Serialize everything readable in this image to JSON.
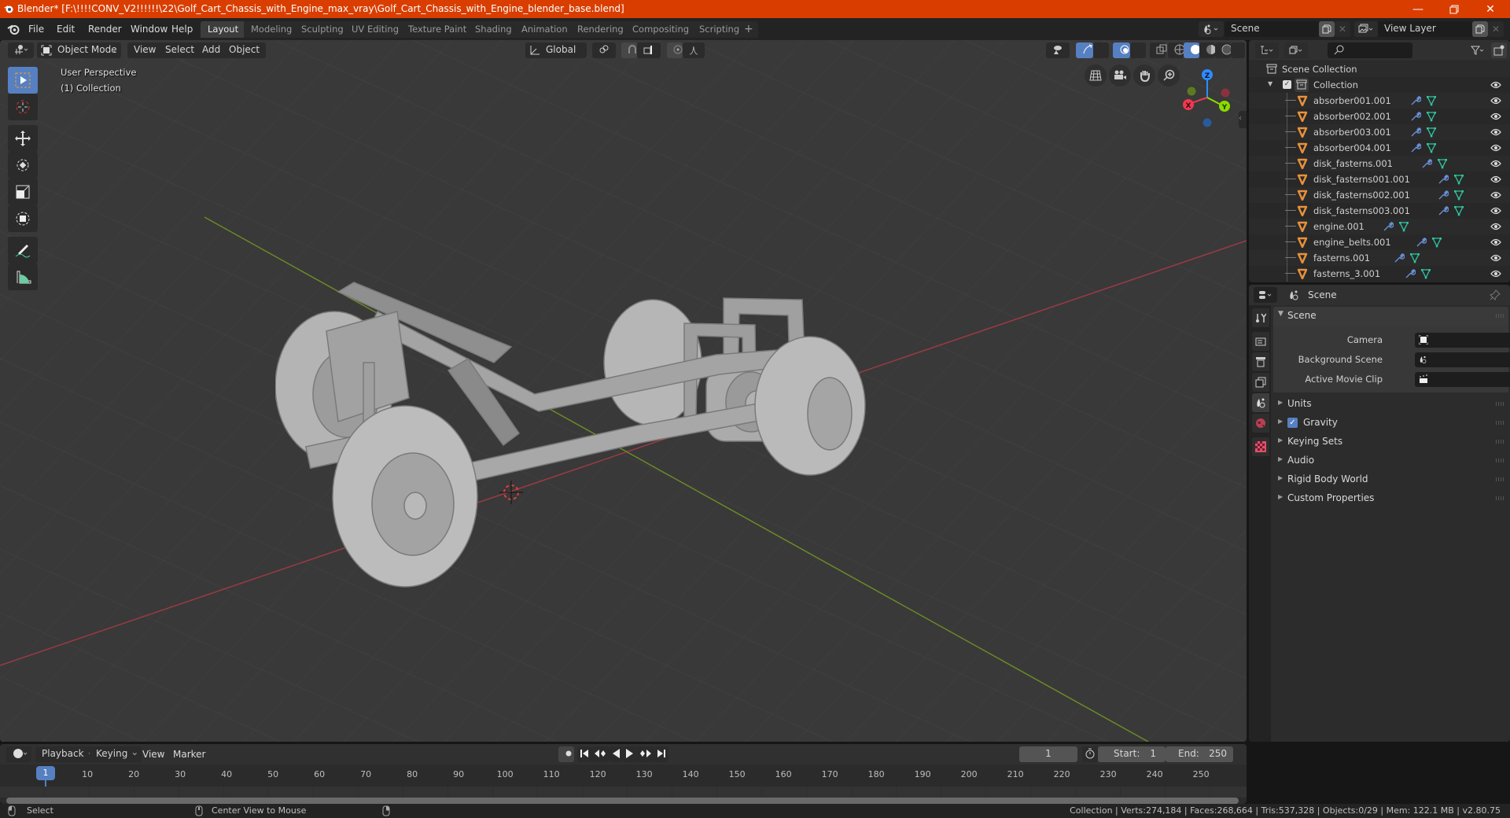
{
  "window": {
    "title": "Blender* [F:\\!!!!CONV_V2!!!!!!\\22\\Golf_Cart_Chassis_with_Engine_max_vray\\Golf_Cart_Chassis_with_Engine_blender_base.blend]",
    "minimize_icon": "minimize-icon",
    "maximize_icon": "restore-icon",
    "close_icon": "close-icon"
  },
  "menubar": {
    "items": [
      "File",
      "Edit",
      "Render",
      "Window",
      "Help"
    ],
    "workspaces": [
      "Layout",
      "Modeling",
      "Sculpting",
      "UV Editing",
      "Texture Paint",
      "Shading",
      "Animation",
      "Rendering",
      "Compositing",
      "Scripting"
    ],
    "active_workspace": "Layout",
    "add_workspace": "+",
    "scene": "Scene",
    "view_layer": "View Layer"
  },
  "viewport": {
    "mode": "Object Mode",
    "menus": [
      "View",
      "Select",
      "Add",
      "Object"
    ],
    "orientation": "Global",
    "overlay_title": "User Perspective",
    "overlay_collection": "(1) Collection",
    "tools": [
      "select-box",
      "cursor",
      "move",
      "rotate",
      "scale",
      "transform",
      "annotate",
      "measure"
    ],
    "gizmo": {
      "x": "X",
      "y": "Y",
      "z": "Z",
      "x_color": "#f0384f",
      "y_color": "#8bdc00",
      "z_color": "#2e8cff"
    }
  },
  "outliner": {
    "root": "Scene Collection",
    "collection": "Collection",
    "items": [
      "absorber001.001",
      "absorber002.001",
      "absorber003.001",
      "absorber004.001",
      "disk_fasterns.001",
      "disk_fasterns001.001",
      "disk_fasterns002.001",
      "disk_fasterns003.001",
      "engine.001",
      "engine_belts.001",
      "fasterns.001",
      "fasterns_3.001"
    ]
  },
  "properties": {
    "context": "Scene",
    "panel_title": "Scene",
    "fields": [
      {
        "label": "Camera",
        "value": ""
      },
      {
        "label": "Background Scene",
        "value": ""
      },
      {
        "label": "Active Movie Clip",
        "value": ""
      }
    ],
    "subpanels": [
      "Units",
      "Gravity",
      "Keying Sets",
      "Audio",
      "Rigid Body World",
      "Custom Properties"
    ],
    "gravity_checked": true
  },
  "timeline": {
    "menus": [
      "Playback",
      "Keying",
      "View",
      "Marker"
    ],
    "current_frame": "1",
    "start_label": "Start:",
    "start": "1",
    "end_label": "End:",
    "end": "250",
    "ticks": [
      "10",
      "20",
      "30",
      "40",
      "50",
      "60",
      "70",
      "80",
      "90",
      "100",
      "110",
      "120",
      "130",
      "140",
      "150",
      "160",
      "170",
      "180",
      "190",
      "200",
      "210",
      "220",
      "230",
      "240",
      "250"
    ],
    "playhead": "1"
  },
  "statusbar": {
    "left_action": "Select",
    "middle_action": "Center View to Mouse",
    "stats": "Collection | Verts:274,184 | Faces:268,664 | Tris:537,328 | Objects:0/29 | Mem: 122.1 MB | v2.80.75"
  }
}
